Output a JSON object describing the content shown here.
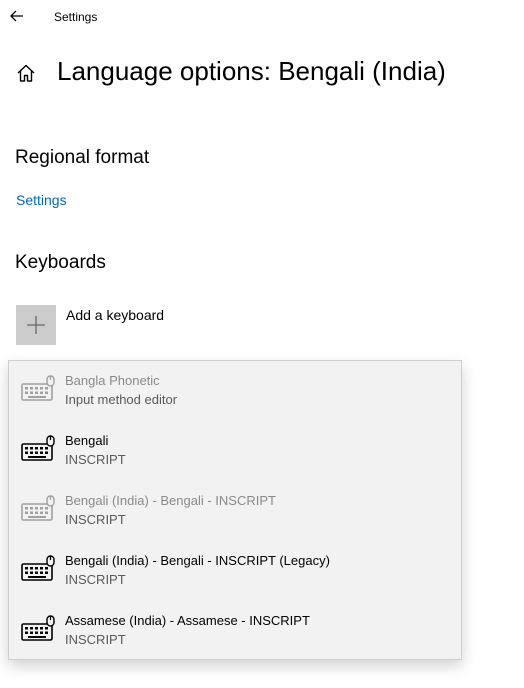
{
  "window": {
    "title": "Settings"
  },
  "page": {
    "title": "Language options: Bengali (India)"
  },
  "regional_format": {
    "heading": "Regional format",
    "link_label": "Settings"
  },
  "keyboards": {
    "heading": "Keyboards",
    "add_label": "Add a keyboard",
    "options": [
      {
        "name": "Bangla Phonetic",
        "type": "Input method editor",
        "enabled": false
      },
      {
        "name": "Bengali",
        "type": "INSCRIPT",
        "enabled": true
      },
      {
        "name": "Bengali (India) - Bengali - INSCRIPT",
        "type": "INSCRIPT",
        "enabled": false
      },
      {
        "name": "Bengali (India) - Bengali - INSCRIPT (Legacy)",
        "type": "INSCRIPT",
        "enabled": true
      },
      {
        "name": "Assamese (India) - Assamese - INSCRIPT",
        "type": "INSCRIPT",
        "enabled": true
      }
    ]
  },
  "icons": {
    "back": "back-arrow-icon",
    "home": "home-icon",
    "add": "plus-icon",
    "keyboard": "keyboard-icon"
  },
  "colors": {
    "link": "#0067c0",
    "add_tile": "#cccccc",
    "enabled_icon": "#000000",
    "disabled_icon": "#a0a0a0"
  }
}
